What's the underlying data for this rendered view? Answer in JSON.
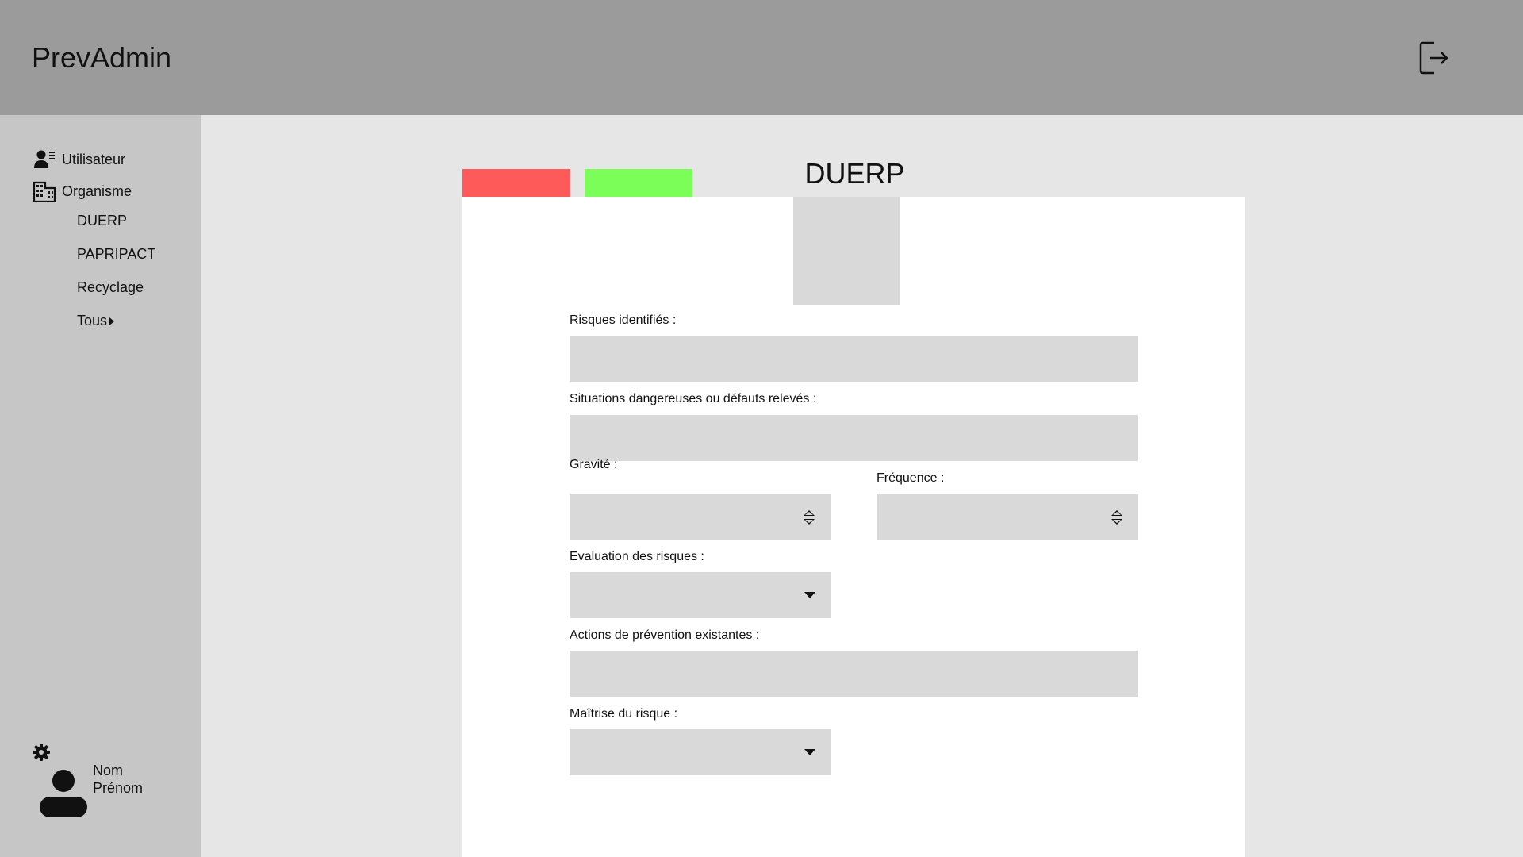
{
  "app": {
    "title": "PrevAdmin"
  },
  "sidebar": {
    "items": [
      {
        "label": "Utilisateur",
        "icon": "user-list-icon"
      },
      {
        "label": "Organisme",
        "icon": "building-icon"
      }
    ],
    "sub_items": [
      {
        "label": "DUERP"
      },
      {
        "label": "PAPRIPACT"
      },
      {
        "label": "Recyclage"
      },
      {
        "label": "Tous"
      }
    ],
    "user": {
      "first_line": "Nom",
      "second_line": "Prénom"
    }
  },
  "main": {
    "title": "DUERP",
    "tab_colors": {
      "red": "#ff5a5a",
      "green": "#7bff58"
    },
    "form": {
      "risques_label": "Risques identifiés :",
      "risques_value": "",
      "situations_label": "Situations dangereuses ou défauts relevés :",
      "situations_value": "",
      "gravite_label": "Gravité :",
      "gravite_value": "",
      "frequence_label": "Fréquence :",
      "frequence_value": "",
      "evaluation_label": "Evaluation des risques :",
      "evaluation_value": "",
      "actions_label": "Actions de prévention existantes :",
      "actions_value": "",
      "maitrise_label": "Maîtrise du risque :",
      "maitrise_value": ""
    }
  }
}
